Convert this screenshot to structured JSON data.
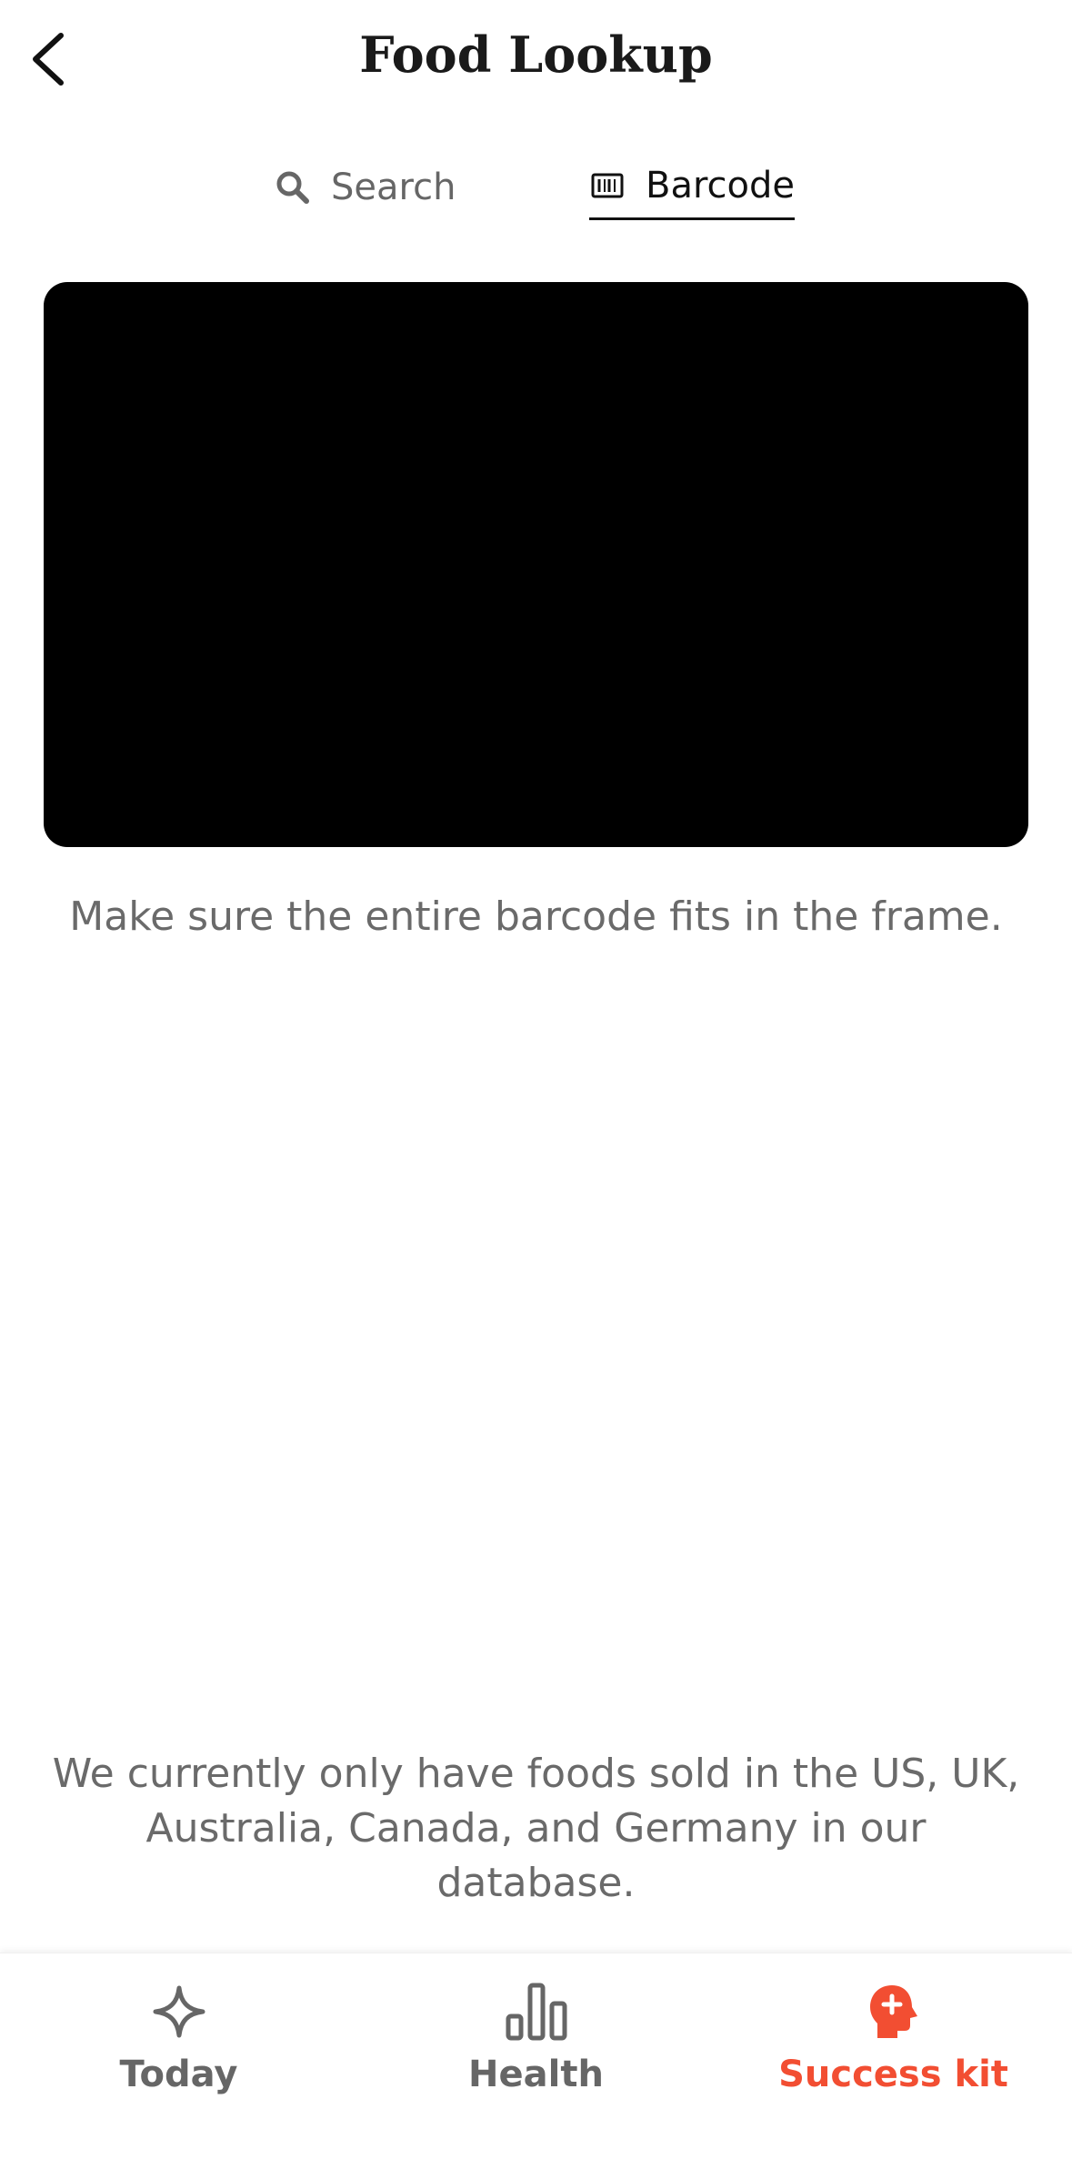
{
  "header": {
    "title": "Food Lookup",
    "back_icon": "chevron-left-icon"
  },
  "tabs": [
    {
      "label": "Search",
      "icon": "search-icon",
      "active": false
    },
    {
      "label": "Barcode",
      "icon": "barcode-icon",
      "active": true
    }
  ],
  "scanner": {
    "hint": "Make sure the entire barcode fits in the frame."
  },
  "disclaimer": {
    "line1": "We currently only have foods sold in the US, UK,",
    "line2": "Australia, Canada, and Germany in our",
    "line3": "database."
  },
  "bottom_nav": {
    "items": [
      {
        "label": "Today",
        "icon": "sparkle-icon",
        "active": false
      },
      {
        "label": "Health",
        "icon": "bar-chart-icon",
        "active": false
      },
      {
        "label": "Success kit",
        "icon": "head-plus-icon",
        "active": true
      }
    ]
  },
  "colors": {
    "accent": "#f24e32",
    "inactive": "#666666",
    "text_dark": "#111111",
    "camera_bg": "#000000"
  }
}
